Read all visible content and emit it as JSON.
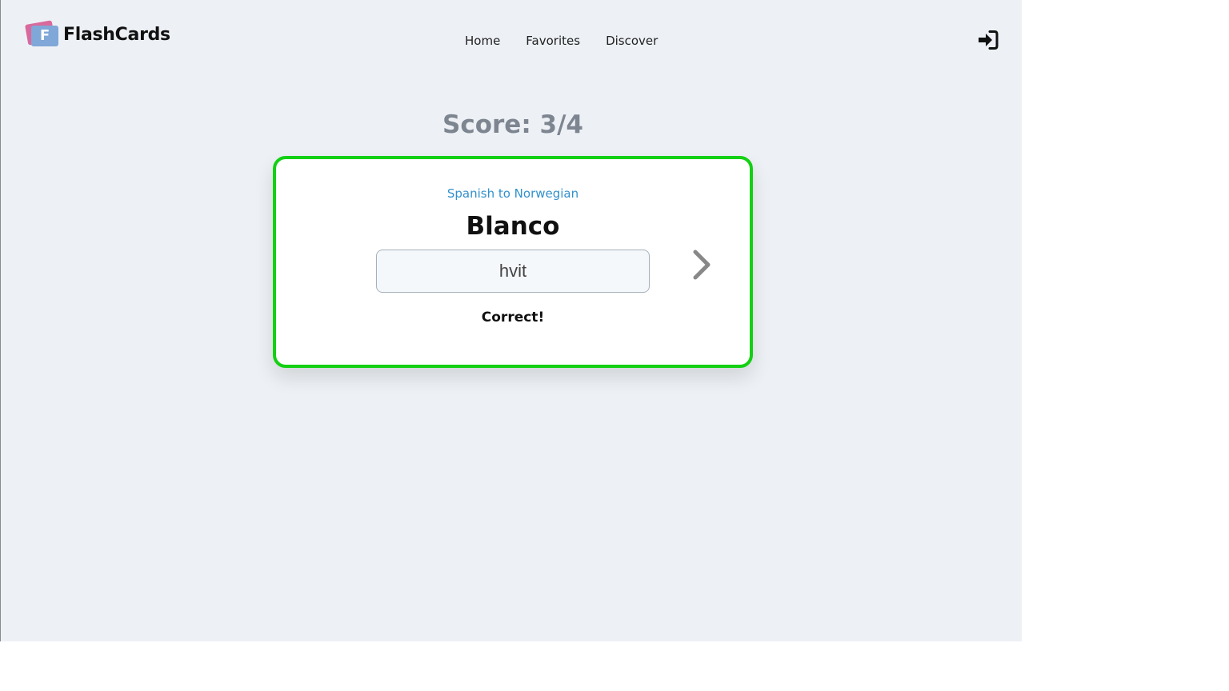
{
  "brand": {
    "logo_letter": "F",
    "name": "FlashCards"
  },
  "nav": {
    "items": [
      {
        "label": "Home"
      },
      {
        "label": "Favorites"
      },
      {
        "label": "Discover"
      }
    ]
  },
  "header": {
    "login_icon": "sign-in-icon"
  },
  "quiz": {
    "score_text": "Score: 3/4",
    "card": {
      "direction": "Spanish to Norwegian",
      "word": "Blanco",
      "answer_value": "hvit",
      "feedback": "Correct!",
      "next_icon": "chevron-right-icon"
    }
  },
  "colors": {
    "page_background": "#edf1f5",
    "card_border_correct": "#13d013",
    "direction_text": "#3390cc",
    "score_text": "#7d8590",
    "logo_back": "#d9699c",
    "logo_front": "#7fa7d8"
  }
}
